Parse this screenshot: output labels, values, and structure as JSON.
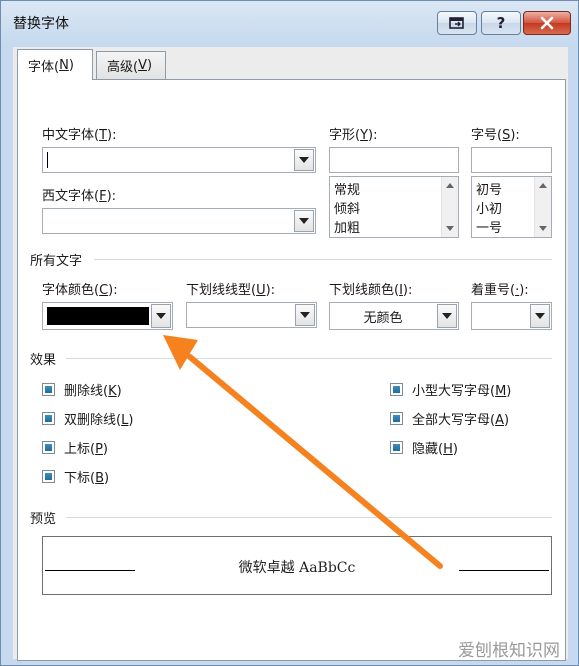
{
  "window": {
    "title": "替换字体"
  },
  "tabs": [
    {
      "label": "字体(",
      "key": "N",
      "end": ")"
    },
    {
      "label": "高级(",
      "key": "V",
      "end": ")"
    }
  ],
  "fields": {
    "cn_font": {
      "label": "中文字体(",
      "key": "T",
      "end": "):"
    },
    "west_font": {
      "label": "西文字体(",
      "key": "F",
      "end": "):"
    },
    "style": {
      "label": "字形(",
      "key": "Y",
      "end": "):",
      "items": [
        "常规",
        "倾斜",
        "加粗"
      ]
    },
    "size": {
      "label": "字号(",
      "key": "S",
      "end": "):",
      "items": [
        "初号",
        "小初",
        "一号"
      ]
    }
  },
  "all_text": {
    "section": "所有文字",
    "color": {
      "label": "字体颜色(",
      "key": "C",
      "end": "):",
      "value": "#000000"
    },
    "underline_type": {
      "label": "下划线线型(",
      "key": "U",
      "end": "):"
    },
    "underline_color": {
      "label": "下划线颜色(",
      "key": "I",
      "end": "):",
      "value": "无颜色"
    },
    "emphasis": {
      "label": "着重号(",
      "key": "·",
      "end": "):"
    }
  },
  "effects": {
    "section": "效果",
    "left": [
      {
        "label": "删除线(",
        "key": "K",
        "end": ")"
      },
      {
        "label": "双删除线(",
        "key": "L",
        "end": ")"
      },
      {
        "label": "上标(",
        "key": "P",
        "end": ")"
      },
      {
        "label": "下标(",
        "key": "B",
        "end": ")"
      }
    ],
    "right": [
      {
        "label": "小型大写字母(",
        "key": "M",
        "end": ")"
      },
      {
        "label": "全部大写字母(",
        "key": "A",
        "end": ")"
      },
      {
        "label": "隐藏(",
        "key": "H",
        "end": ")"
      }
    ]
  },
  "preview": {
    "section": "预览",
    "sample": "微软卓越  AaBbCc"
  },
  "watermark": "爱刨根知识网",
  "colors": {
    "annotation_arrow": "#f5821f",
    "checkbox_fill": "#2a7fae"
  }
}
